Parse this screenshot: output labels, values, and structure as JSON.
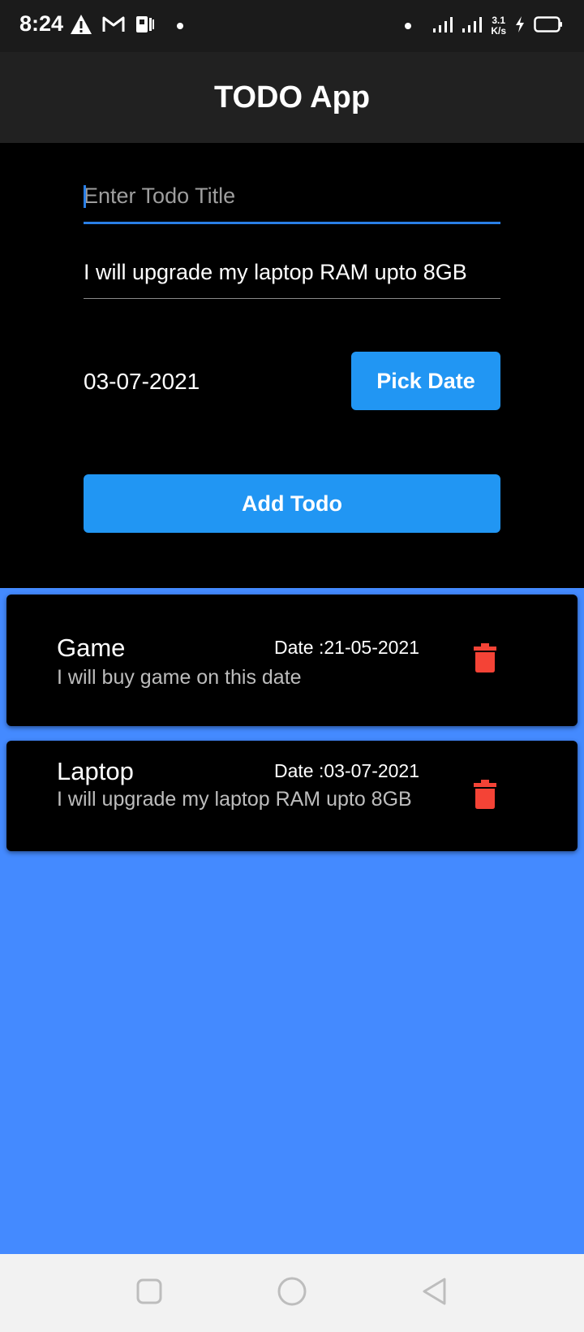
{
  "status_bar": {
    "time": "8:24",
    "net_speed_value": "3.1",
    "net_speed_unit": "K/s",
    "icons": [
      "warning-icon",
      "gmail-icon",
      "app-icon",
      "dot-icon",
      "dot-icon",
      "signal-icon",
      "signal-icon",
      "charging-icon",
      "battery-icon"
    ]
  },
  "app_bar": {
    "title": "TODO App"
  },
  "form": {
    "title_placeholder": "Enter Todo Title",
    "description_value": "I will upgrade my laptop RAM upto 8GB",
    "date_value": "03-07-2021",
    "pick_date_label": "Pick Date",
    "add_todo_label": "Add Todo"
  },
  "todos": [
    {
      "title": "Game",
      "date": "Date :21-05-2021",
      "description": "I will buy game on this date",
      "icon": "trash-icon"
    },
    {
      "title": "Laptop",
      "date": "Date :03-07-2021",
      "description": "I will upgrade my laptop RAM upto 8GB",
      "icon": "trash-icon"
    }
  ],
  "colors": {
    "accent": "#2196f3",
    "list_background": "#448aff",
    "delete_icon": "#f44336",
    "input_focus": "#2a7fe6"
  },
  "nav_bar": {
    "buttons": [
      "recents-icon",
      "home-icon",
      "back-icon"
    ]
  }
}
